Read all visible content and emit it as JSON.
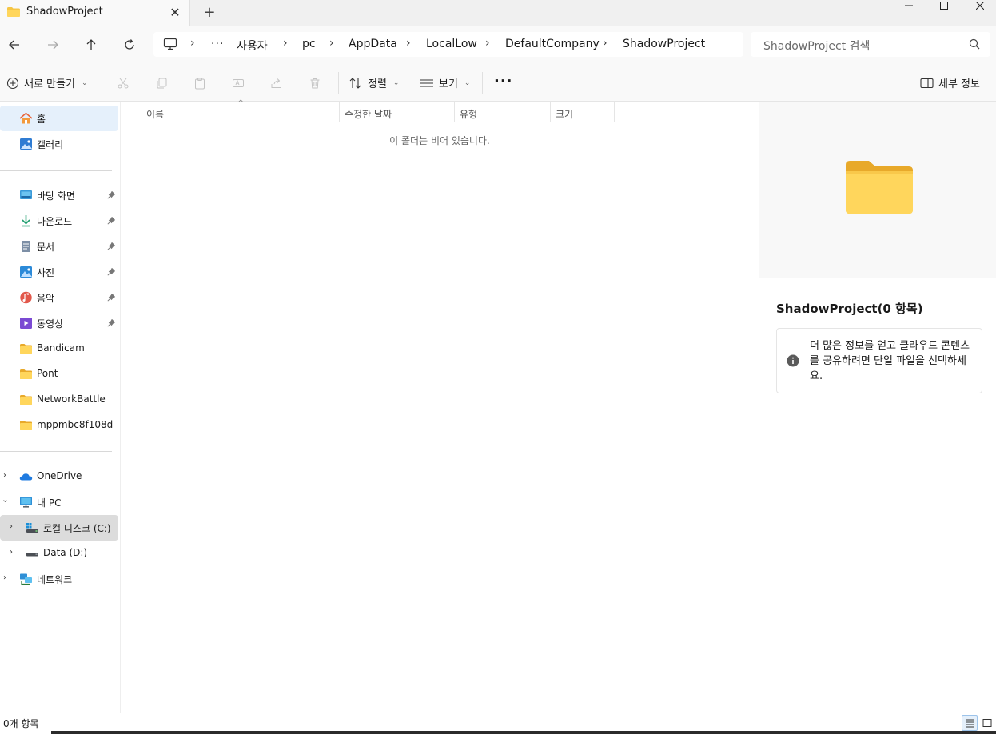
{
  "tab": {
    "title": "ShadowProject",
    "close_glyph": "✕",
    "new_tab_glyph": "+"
  },
  "window": {
    "minimize_glyph": "—",
    "maximize_glyph": "▢",
    "close_glyph": "✕"
  },
  "address": {
    "overflow": "···",
    "crumbs": [
      "사용자",
      "pc",
      "AppData",
      "LocalLow",
      "DefaultCompany",
      "ShadowProject"
    ]
  },
  "search": {
    "placeholder": "ShadowProject 검색"
  },
  "toolbar": {
    "new_label": "새로 만들기",
    "sort_label": "정렬",
    "view_label": "보기",
    "more_glyph": "···",
    "details_label": "세부 정보"
  },
  "sidebar": {
    "quick": [
      {
        "label": "홈",
        "icon": "home-icon"
      },
      {
        "label": "갤러리",
        "icon": "gallery-icon"
      }
    ],
    "pinned": [
      {
        "label": "바탕 화면",
        "icon": "desktop-icon",
        "pinned": true
      },
      {
        "label": "다운로드",
        "icon": "download-icon",
        "pinned": true
      },
      {
        "label": "문서",
        "icon": "document-icon",
        "pinned": true
      },
      {
        "label": "사진",
        "icon": "pictures-icon",
        "pinned": true
      },
      {
        "label": "음악",
        "icon": "music-icon",
        "pinned": true
      },
      {
        "label": "동영상",
        "icon": "video-icon",
        "pinned": true
      },
      {
        "label": "Bandicam",
        "icon": "folder-icon"
      },
      {
        "label": "Pont",
        "icon": "folder-icon"
      },
      {
        "label": "NetworkBattle",
        "icon": "folder-icon"
      },
      {
        "label": "mppmbc8f108d",
        "icon": "folder-icon"
      }
    ],
    "tree": [
      {
        "label": "OneDrive",
        "icon": "onedrive-icon"
      },
      {
        "label": "내 PC",
        "icon": "pc-icon"
      },
      {
        "label": "로컬 디스크 (C:)",
        "icon": "drive-c-icon"
      },
      {
        "label": "Data (D:)",
        "icon": "drive-d-icon"
      },
      {
        "label": "네트워크",
        "icon": "network-icon"
      }
    ]
  },
  "list": {
    "columns": [
      "이름",
      "수정한 날짜",
      "유형",
      "크기"
    ],
    "sort_caret": "^",
    "empty_message": "이 폴더는 비어 있습니다."
  },
  "details": {
    "title": "ShadowProject(0 항목)",
    "info_text": "더 많은 정보를 얻고 클라우드 콘텐츠를 공유하려면 단일 파일을 선택하세요."
  },
  "status": {
    "text": "0개 항목"
  },
  "colors": {
    "folder": "#f6c644",
    "folder_dark": "#e8a92a",
    "accent": "#0067c0"
  }
}
